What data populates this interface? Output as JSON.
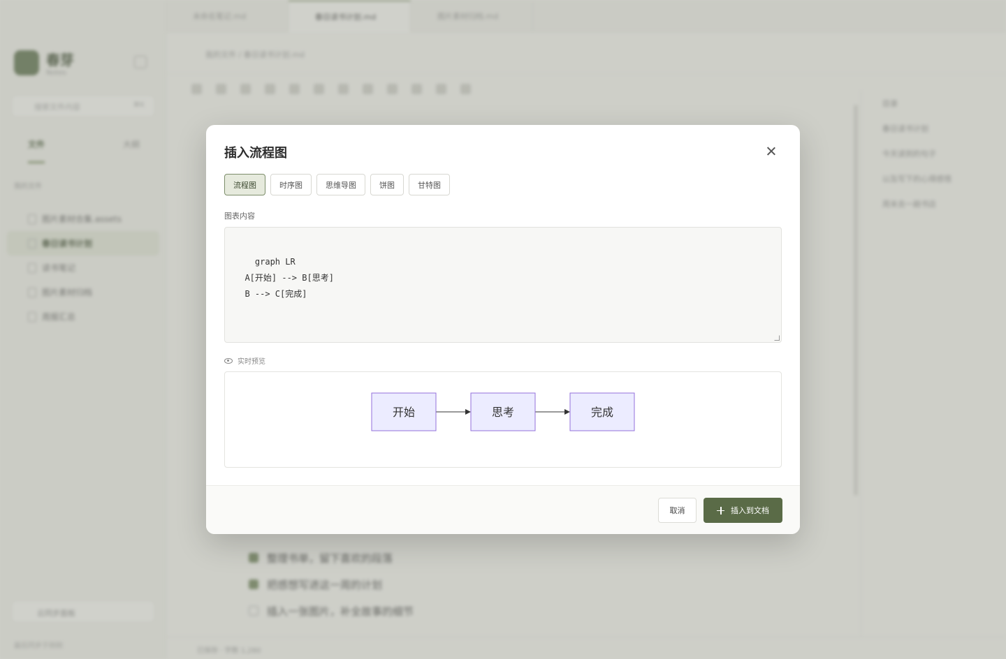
{
  "background": {
    "brand": {
      "name": "春芽",
      "sub": "Notes"
    },
    "search_placeholder": "搜索文件内容",
    "search_shortcut": "⌘K",
    "sidebar_tabs": [
      "文件",
      "大纲"
    ],
    "section_label": "我的文件",
    "files": [
      {
        "label": "图片素材合集.assets"
      },
      {
        "label": "春日读书计划"
      },
      {
        "label": "读书笔记"
      },
      {
        "label": "图片素材归档"
      },
      {
        "label": "周报汇总"
      }
    ],
    "bottom_button": "云同步面板",
    "footer": "最后同步于刚刚",
    "doc_tabs": [
      "未命名笔记.md",
      "春日读书计划.md",
      "图片素材归档.md"
    ],
    "breadcrumb": "我的文件 / 春日读书计划.md",
    "editor_tasks": [
      {
        "text": "整理书单，留下喜欢的段落",
        "done": true
      },
      {
        "text": "把感想写进这一周的计划",
        "done": true
      },
      {
        "text": "插入一张图片，补全故事的细节",
        "done": false
      }
    ],
    "outline": [
      "目录",
      "春日读书计划",
      "今天读到的句子",
      "以及写下的心得感悟",
      "周末去一趟书店"
    ],
    "status": "已保存 · 字数 1,280"
  },
  "modal": {
    "title": "插入流程图",
    "types": [
      {
        "label": "流程图",
        "active": true
      },
      {
        "label": "时序图",
        "active": false
      },
      {
        "label": "思维导图",
        "active": false
      },
      {
        "label": "饼图",
        "active": false
      },
      {
        "label": "甘特图",
        "active": false
      }
    ],
    "content_label": "图表内容",
    "code": "graph LR\n  A[开始] --> B[思考]\n  B --> C[完成]",
    "preview_label": "实时预览",
    "preview_nodes": [
      "开始",
      "思考",
      "完成"
    ],
    "cancel_label": "取消",
    "insert_label": "插入到文档"
  },
  "colors": {
    "accent": "#5a6b47",
    "node_fill": "#ececff",
    "node_stroke": "#9370db"
  }
}
